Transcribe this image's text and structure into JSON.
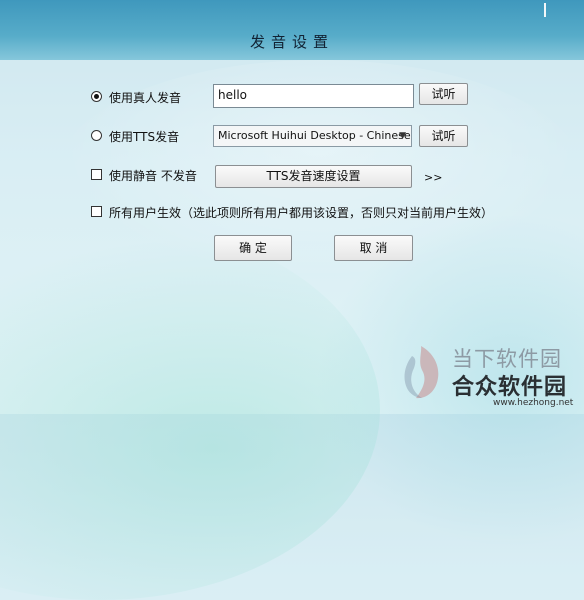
{
  "dialog": {
    "title": "发音设置"
  },
  "options": {
    "real_voice_label": "使用真人发音",
    "real_voice_input": "hello",
    "real_voice_listen": "试听",
    "tts_label": "使用TTS发音",
    "tts_voice_selected": "Microsoft Huihui Desktop - Chinese (S",
    "tts_listen": "试听",
    "mute_label": "使用静音 不发音",
    "tts_speed_button": "TTS发音速度设置",
    "tts_speed_more": ">>",
    "all_users_label": "所有用户生效（选此项则所有用户都用该设置，否则只对当前用户生效）"
  },
  "actions": {
    "ok": "确 定",
    "cancel": "取 消"
  },
  "watermark": {
    "line1": "当下软件园",
    "line2": "合众软件园",
    "url": "www.hezhong.net"
  }
}
